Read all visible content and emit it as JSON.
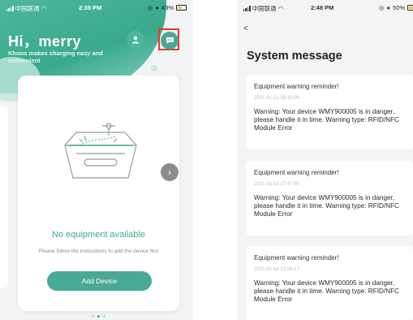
{
  "left_screen": {
    "status_bar": {
      "carrier": "中国联通",
      "time": "2:39 PM",
      "battery": "43%"
    },
    "greeting": "Hi，merry",
    "tagline": "Khons makes charging easy and convenient",
    "empty_state": {
      "title": "No equipment available",
      "instructions": "Please follow the instructions to add the device first"
    },
    "add_button": "Add Device",
    "icons": {
      "profile": "person-icon",
      "messages": "chat-bubble-icon",
      "next": "chevron-right-icon"
    },
    "colors": {
      "accent": "#4aa994",
      "highlight_border": "#e23a2e"
    }
  },
  "right_screen": {
    "status_bar": {
      "carrier": "中国联通",
      "time": "2:48 PM",
      "battery": "50%"
    },
    "back": "<",
    "title": "System message",
    "messages": [
      {
        "title": "Equipment warning reminder!",
        "time": "2021-01-21 08:18:06",
        "body": "Warning: Your device WMY900005 is in danger, please handle it in time. Warning type: RFID/NFC Module Error"
      },
      {
        "title": "Equipment warning reminder!",
        "time": "2021-01-18 17:47:06",
        "body": "Warning: Your device WMY900005 is in danger, please handle it in time. Warning type: RFID/NFC Module Error"
      },
      {
        "title": "Equipment warning reminder!",
        "time": "2021-01-14 13:56:17",
        "body": "Warning: Your device WMY900005 is in danger, please handle it in time. Warning type: RFID/NFC Module Error"
      }
    ]
  }
}
